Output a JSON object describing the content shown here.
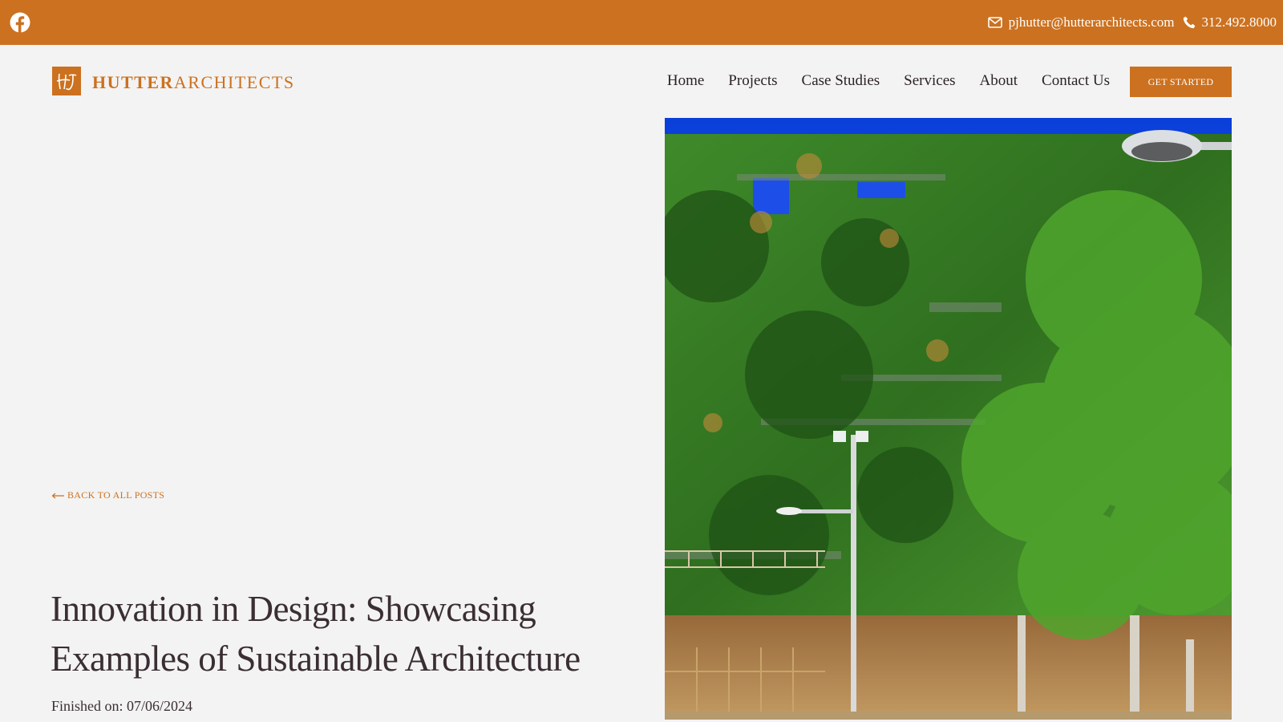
{
  "topbar": {
    "social_icon": "facebook-icon",
    "email_icon": "envelope-icon",
    "email": "pjhutter@hutterarchitects.com",
    "phone_icon": "phone-icon",
    "phone": "312.492.8000",
    "background": "#cc711f"
  },
  "header": {
    "logo": {
      "strong": "HUTTER",
      "light": "ARCHITECTS"
    },
    "nav": [
      "Home",
      "Projects",
      "Case Studies",
      "Services",
      "About",
      "Contact Us"
    ],
    "cta_label": "GET STARTED"
  },
  "post": {
    "back_label": "BACK TO ALL POSTS",
    "title": "Innovation in Design: Showcasing Examples of Sustainable Architecture",
    "finished": "Finished on: 07/06/2024"
  },
  "colors": {
    "accent": "#cc711f",
    "background": "#f3f3f3",
    "text": "#3a2e33"
  }
}
